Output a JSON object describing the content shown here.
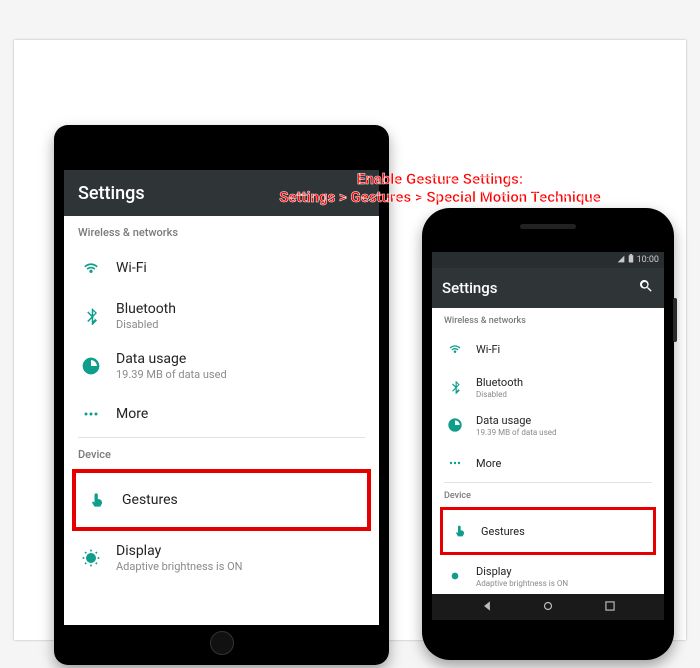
{
  "annotation": {
    "line1": "Enable Gesture Settings:",
    "line2": "Settings > Gestures > Special Motion Technique"
  },
  "statusbar": {
    "time": "10:00"
  },
  "appbar_title": "Settings",
  "sections": {
    "wireless": "Wireless & networks",
    "device": "Device"
  },
  "items": {
    "wifi": {
      "label": "Wi-Fi",
      "sub": ""
    },
    "bluetooth": {
      "label": "Bluetooth",
      "sub": "Disabled"
    },
    "data": {
      "label": "Data usage",
      "sub": "19.39 MB of data used"
    },
    "more": {
      "label": "More",
      "sub": ""
    },
    "gestures": {
      "label": "Gestures",
      "sub": ""
    },
    "display": {
      "label": "Display",
      "sub": "Adaptive brightness is ON"
    }
  },
  "colors": {
    "accent": "#0f9d8c",
    "highlight": "#e60000"
  }
}
